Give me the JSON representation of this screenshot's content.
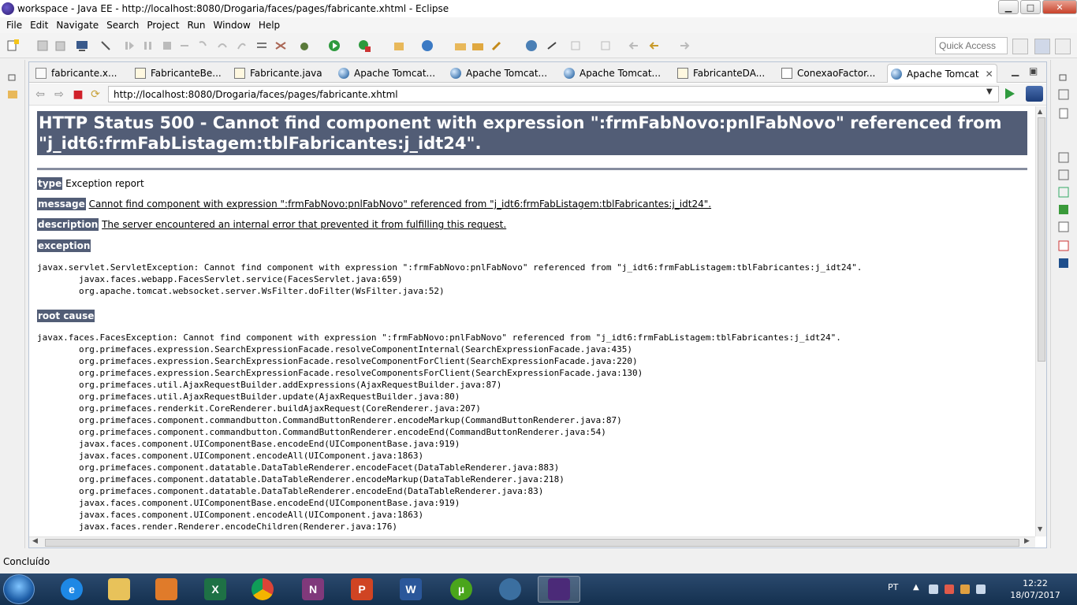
{
  "window": {
    "title": "workspace - Java EE - http://localhost:8080/Drogaria/faces/pages/fabricante.xhtml - Eclipse",
    "minimize_glyph": "▁",
    "maximize_glyph": "□",
    "close_glyph": "✕"
  },
  "menu": [
    "File",
    "Edit",
    "Navigate",
    "Search",
    "Project",
    "Run",
    "Window",
    "Help"
  ],
  "toolbar": {
    "quick_access_placeholder": "Quick Access"
  },
  "tabs": [
    {
      "label": "fabricante.x...",
      "icon": "xml-file-icon"
    },
    {
      "label": "FabricanteBe...",
      "icon": "java-file-icon"
    },
    {
      "label": "Fabricante.java",
      "icon": "java-file-icon"
    },
    {
      "label": "Apache Tomcat...",
      "icon": "globe-icon"
    },
    {
      "label": "Apache Tomcat...",
      "icon": "globe-icon"
    },
    {
      "label": "Apache Tomcat...",
      "icon": "globe-icon"
    },
    {
      "label": "FabricanteDA...",
      "icon": "java-file-icon"
    },
    {
      "label": "ConexaoFactor...",
      "icon": "java-file-icon"
    },
    {
      "label": "Apache Tomcat",
      "icon": "globe-icon",
      "active": true
    }
  ],
  "browser": {
    "url": "http://localhost:8080/Drogaria/faces/pages/fabricante.xhtml"
  },
  "page": {
    "heading": "HTTP Status 500 - Cannot find component with expression \":frmFabNovo:pnlFabNovo\" referenced from \"j_idt6:frmFabListagem:tblFabricantes:j_idt24\".",
    "type_label": "type",
    "type_value": "Exception report",
    "message_label": "message",
    "message_value": "Cannot find component with expression \":frmFabNovo:pnlFabNovo\" referenced from \"j_idt6:frmFabListagem:tblFabricantes:j_idt24\".",
    "description_label": "description",
    "description_value": "The server encountered an internal error that prevented it from fulfilling this request.",
    "exception_label": "exception",
    "exception_trace": "javax.servlet.ServletException: Cannot find component with expression \":frmFabNovo:pnlFabNovo\" referenced from \"j_idt6:frmFabListagem:tblFabricantes:j_idt24\".\n\tjavax.faces.webapp.FacesServlet.service(FacesServlet.java:659)\n\torg.apache.tomcat.websocket.server.WsFilter.doFilter(WsFilter.java:52)",
    "root_cause_label": "root cause",
    "root_cause_trace": "javax.faces.FacesException: Cannot find component with expression \":frmFabNovo:pnlFabNovo\" referenced from \"j_idt6:frmFabListagem:tblFabricantes:j_idt24\".\n\torg.primefaces.expression.SearchExpressionFacade.resolveComponentInternal(SearchExpressionFacade.java:435)\n\torg.primefaces.expression.SearchExpressionFacade.resolveComponentForClient(SearchExpressionFacade.java:220)\n\torg.primefaces.expression.SearchExpressionFacade.resolveComponentsForClient(SearchExpressionFacade.java:130)\n\torg.primefaces.util.AjaxRequestBuilder.addExpressions(AjaxRequestBuilder.java:87)\n\torg.primefaces.util.AjaxRequestBuilder.update(AjaxRequestBuilder.java:80)\n\torg.primefaces.renderkit.CoreRenderer.buildAjaxRequest(CoreRenderer.java:207)\n\torg.primefaces.component.commandbutton.CommandButtonRenderer.encodeMarkup(CommandButtonRenderer.java:87)\n\torg.primefaces.component.commandbutton.CommandButtonRenderer.encodeEnd(CommandButtonRenderer.java:54)\n\tjavax.faces.component.UIComponentBase.encodeEnd(UIComponentBase.java:919)\n\tjavax.faces.component.UIComponent.encodeAll(UIComponent.java:1863)\n\torg.primefaces.component.datatable.DataTableRenderer.encodeFacet(DataTableRenderer.java:883)\n\torg.primefaces.component.datatable.DataTableRenderer.encodeMarkup(DataTableRenderer.java:218)\n\torg.primefaces.component.datatable.DataTableRenderer.encodeEnd(DataTableRenderer.java:83)\n\tjavax.faces.component.UIComponentBase.encodeEnd(UIComponentBase.java:919)\n\tjavax.faces.component.UIComponent.encodeAll(UIComponent.java:1863)\n\tjavax.faces.render.Renderer.encodeChildren(Renderer.java:176)"
  },
  "status": {
    "text": "Concluído"
  },
  "taskbar": {
    "apps": [
      {
        "name": "internet-explorer",
        "glyph": "e",
        "color": "#1e88e5"
      },
      {
        "name": "file-explorer",
        "glyph": "",
        "color": "#e8c25a"
      },
      {
        "name": "media-player",
        "glyph": "",
        "color": "#e07b2a"
      },
      {
        "name": "excel",
        "glyph": "X",
        "color": "#1e7145"
      },
      {
        "name": "chrome",
        "glyph": "",
        "color": "#db4437"
      },
      {
        "name": "onenote",
        "glyph": "N",
        "color": "#80397b"
      },
      {
        "name": "powerpoint",
        "glyph": "P",
        "color": "#d04423"
      },
      {
        "name": "word",
        "glyph": "W",
        "color": "#2b579a"
      },
      {
        "name": "utorrent",
        "glyph": "µ",
        "color": "#4aa51c"
      },
      {
        "name": "postgresql",
        "glyph": "",
        "color": "#3b6fa0"
      },
      {
        "name": "eclipse-javaee",
        "glyph": "",
        "color": "#4b2a78",
        "active": true
      }
    ],
    "language": "PT",
    "time": "12:22",
    "date": "18/07/2017"
  }
}
